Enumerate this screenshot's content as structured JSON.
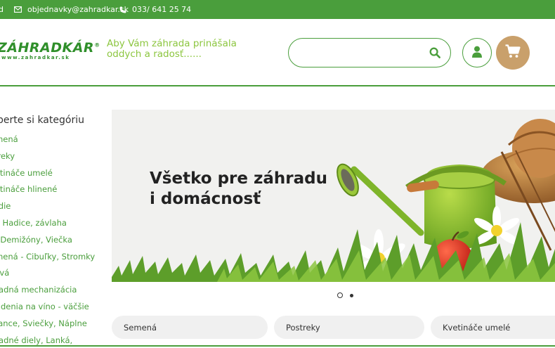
{
  "topbar": {
    "cut_label": "d",
    "email": "objednavky@zahradkar.sk",
    "phone": "033/ 641 25 74"
  },
  "header": {
    "logo_main": "ZÁHRADKÁR",
    "logo_reg": "®",
    "logo_sub": "www.zahradkar.sk",
    "tagline_line1": "Aby Vám záhrada prinášala",
    "tagline_line2": "oddych a radosť......",
    "search_placeholder": "",
    "search_value": ""
  },
  "sidebar": {
    "title": "berte si kategóriu",
    "items": [
      {
        "label": "emená"
      },
      {
        "label": "streky"
      },
      {
        "label": "vetináče umelé"
      },
      {
        "label": "vetináče hlinené"
      },
      {
        "label": "radie"
      },
      {
        "label": "ia, Hadice, závlaha"
      },
      {
        "label": "o, Demižóny, Viečka"
      },
      {
        "label": "emená - Cibuľky, Stromky"
      },
      {
        "label": "ojivá"
      },
      {
        "label": "hradná mechanizácia"
      },
      {
        "label": "riadenia na víno - väčšie"
      },
      {
        "label": "mance, Sviečky, Náplne"
      },
      {
        "label": "hradné diely, Lanká,"
      }
    ]
  },
  "banner": {
    "title_line1": "Všetko pre záhradu",
    "title_line2": "i domácnosť",
    "slide_count": 2,
    "active_slide": 1
  },
  "categories": [
    {
      "label": "Semená"
    },
    {
      "label": "Postreky"
    },
    {
      "label": "Kvetináče umelé"
    }
  ],
  "colors": {
    "brand_green": "#4a9e3c",
    "tagline_green": "#8cc63f",
    "cart_tan": "#c9a06b"
  }
}
